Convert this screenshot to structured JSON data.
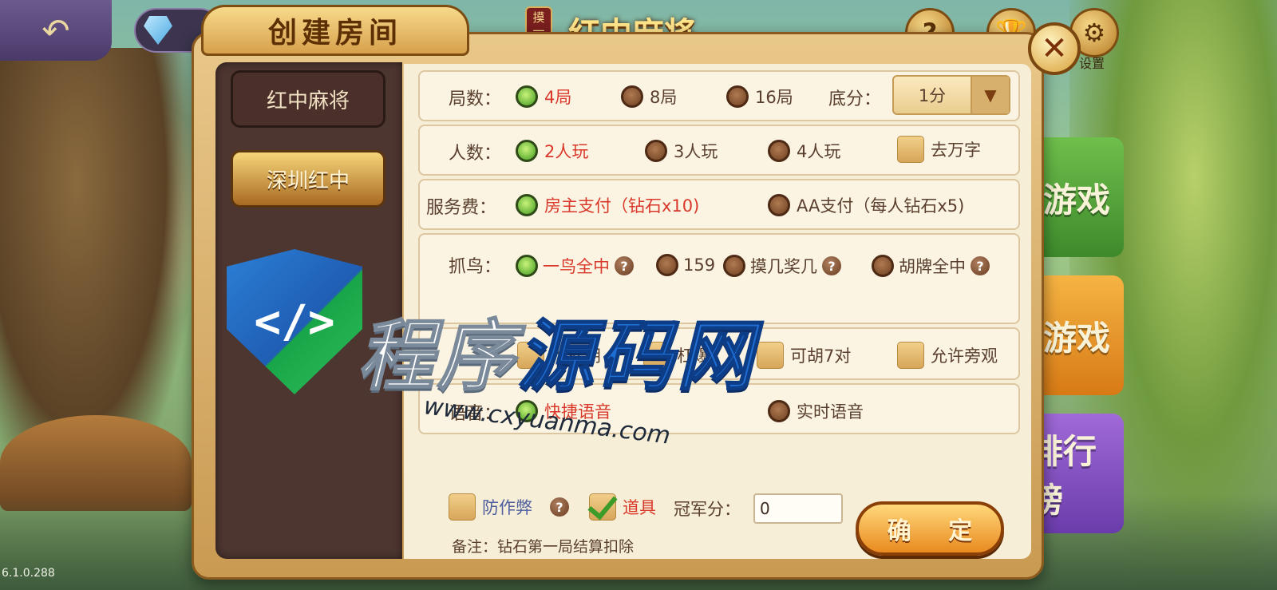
{
  "top_bar": {
    "game_tag": "摸一把",
    "game_name": "红中麻将",
    "settings_label": "设置",
    "help_glyph": "?",
    "back_glyph": "↶"
  },
  "side_buttons": [
    "游戏",
    "游戏",
    "排行榜"
  ],
  "version": "6.1.0.288",
  "dialog": {
    "title": "创建房间",
    "close_glyph": "✕",
    "tabs": [
      {
        "label": "红中麻将",
        "active": false
      },
      {
        "label": "深圳红中",
        "active": true
      }
    ],
    "rounds": {
      "label": "局数：",
      "options": [
        {
          "label": "4局",
          "selected": true
        },
        {
          "label": "8局",
          "selected": false
        },
        {
          "label": "16局",
          "selected": false
        }
      ]
    },
    "base_score": {
      "label": "底分：",
      "value": "1分",
      "arrow": "▼"
    },
    "players": {
      "label": "人数：",
      "options": [
        {
          "label": "2人玩",
          "selected": true
        },
        {
          "label": "3人玩",
          "selected": false
        },
        {
          "label": "4人玩",
          "selected": false
        }
      ],
      "checkbox": {
        "label": "去万字",
        "checked": false
      }
    },
    "fee": {
      "label": "服务费：",
      "options": [
        {
          "label": "房主支付（钻石x10)",
          "selected": true
        },
        {
          "label": "AA支付（每人钻石x5)",
          "selected": false
        }
      ]
    },
    "bird": {
      "label": "抓鸟：",
      "options": [
        {
          "label": "一鸟全中",
          "selected": true,
          "help": true
        },
        {
          "label": "159",
          "selected": false,
          "help": false
        },
        {
          "label": "摸几奖几",
          "selected": false,
          "help": true
        },
        {
          "label": "胡牌全中",
          "selected": false,
          "help": true
        }
      ]
    },
    "extras": [
      {
        "label": "抢杠胡",
        "checked": false
      },
      {
        "label": "杠爆",
        "checked": false
      },
      {
        "label": "可胡7对",
        "checked": false
      },
      {
        "label": "允许旁观",
        "checked": false
      }
    ],
    "voice": {
      "label": "语音：",
      "options": [
        {
          "label": "快捷语音",
          "selected": true
        },
        {
          "label": "实时语音",
          "selected": false
        }
      ]
    },
    "anti_cheat": {
      "label": "防作弊",
      "checked": false
    },
    "props": {
      "label": "道具",
      "checked": true
    },
    "champion": {
      "label": "冠军分：",
      "value": "0"
    },
    "confirm_label": "确 定",
    "note": "备注：钻石第一局结算扣除"
  },
  "watermark": {
    "shield_text": "</>",
    "title_part1": "程序",
    "title_part2": "源码网",
    "url": "www.cxyuanma.com"
  }
}
